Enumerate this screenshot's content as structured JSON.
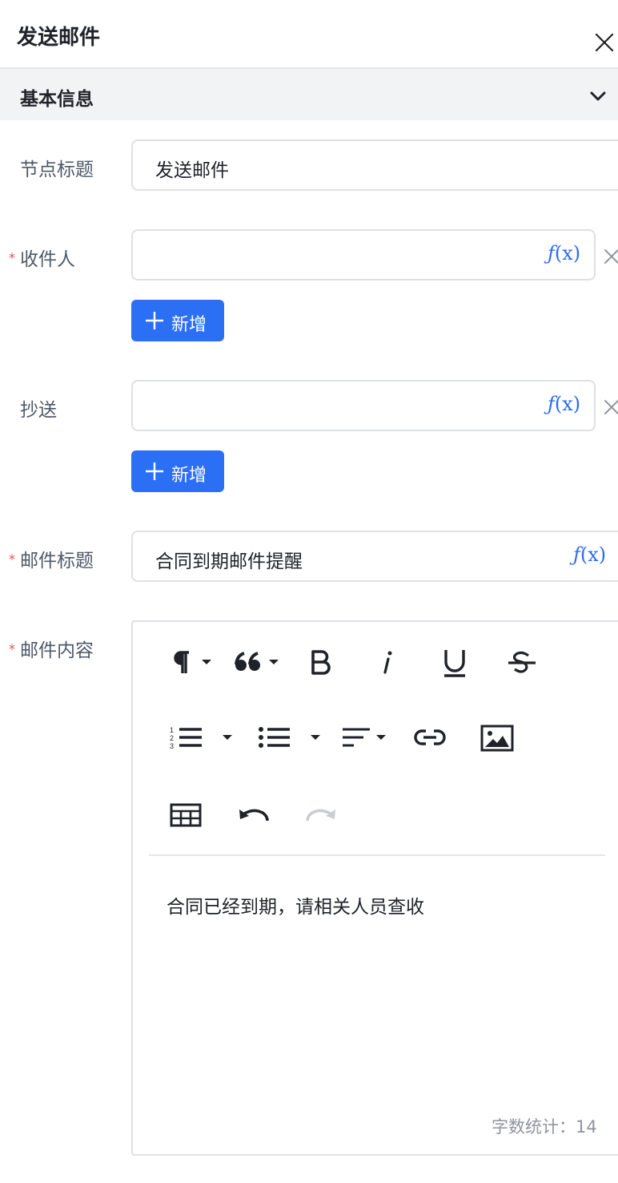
{
  "header": {
    "title": "发送邮件",
    "close_icon": "close-icon"
  },
  "section": {
    "title": "基本信息",
    "expand_icon": "chevron-down-icon"
  },
  "fields": {
    "node_title": {
      "label": "节点标题",
      "value": "发送邮件"
    },
    "recipient": {
      "label": "收件人",
      "required_mark": "*",
      "value": "",
      "fx_symbol": "ƒ",
      "fx_args": "(x)"
    },
    "cc": {
      "label": "抄送",
      "value": "",
      "fx_symbol": "ƒ",
      "fx_args": "(x)"
    },
    "mail_subject": {
      "label": "邮件标题",
      "required_mark": "*",
      "value": "合同到期邮件提醒",
      "fx_symbol": "ƒ",
      "fx_args": "(x)"
    },
    "mail_body": {
      "label": "邮件内容",
      "required_mark": "*"
    }
  },
  "add_button": {
    "label": "新增"
  },
  "editor": {
    "content": "合同已经到期，请相关人员查收",
    "word_count": "字数统计：14",
    "toolbar": [
      "paragraph-icon",
      "blockquote-icon",
      "bold-icon",
      "italic-icon",
      "underline-icon",
      "strikethrough-icon",
      "ordered-list-icon",
      "bullet-list-icon",
      "align-icon",
      "link-icon",
      "image-icon",
      "table-icon",
      "undo-icon",
      "redo-icon"
    ]
  },
  "colors": {
    "primary": "#2b6ff5",
    "fx": "#2b6bf3",
    "required": "#f54a45",
    "label": "#4e5969",
    "border": "#dee0e3",
    "section_bg": "#f2f3f5",
    "muted": "#8f959e"
  }
}
